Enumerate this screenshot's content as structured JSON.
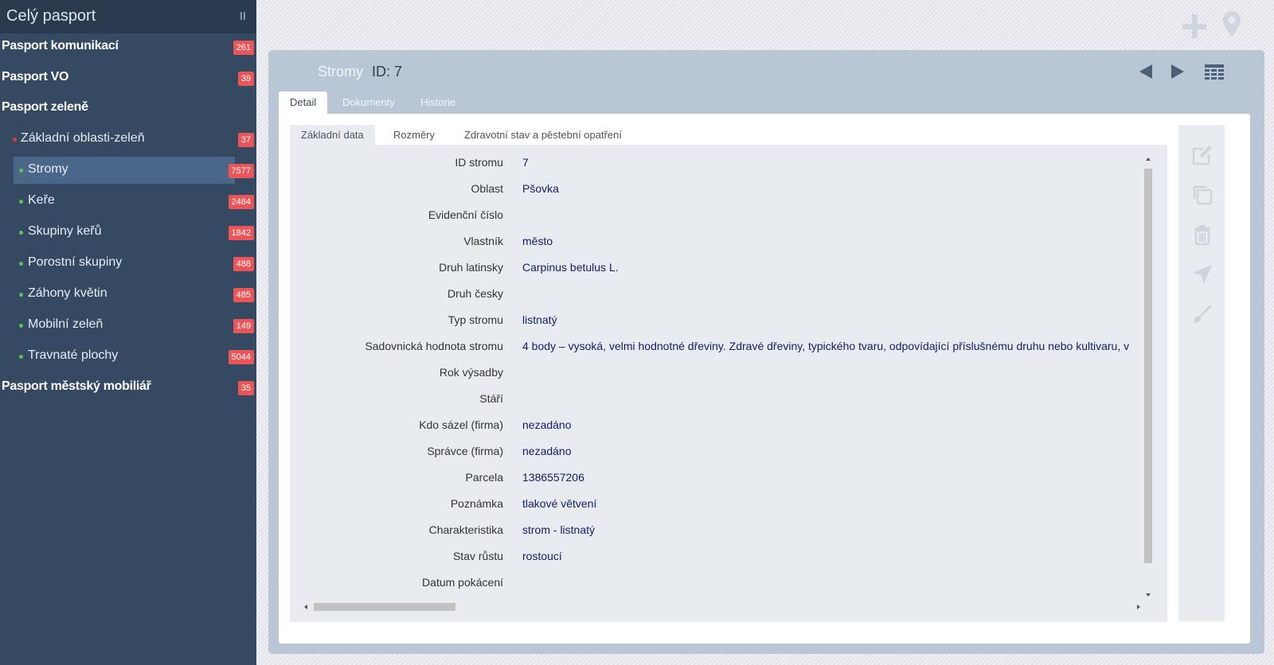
{
  "sidebar": {
    "title": "Celý pasport",
    "items": [
      {
        "label": "Pasport komunikací",
        "count": "261"
      },
      {
        "label": "Pasport VO",
        "count": "39"
      },
      {
        "label": "Pasport zeleně",
        "count": ""
      },
      {
        "label": "Základní oblasti-zeleň",
        "count": "37"
      },
      {
        "label": "Stromy",
        "count": "7577"
      },
      {
        "label": "Keře",
        "count": "2484"
      },
      {
        "label": "Skupiny keřů",
        "count": "1842"
      },
      {
        "label": "Porostní skupiny",
        "count": "488"
      },
      {
        "label": "Záhony květin",
        "count": "485"
      },
      {
        "label": "Mobilní zeleň",
        "count": "149"
      },
      {
        "label": "Travnaté plochy",
        "count": "5044"
      },
      {
        "label": "Pasport městský mobiliář",
        "count": "35"
      }
    ]
  },
  "header": {
    "entity": "Stromy",
    "id_label": "ID: 7"
  },
  "tabs_outer": [
    "Detail",
    "Dokumenty",
    "Historie"
  ],
  "tabs_inner": [
    "Základní data",
    "Rozměry",
    "Zdravotní stav a pěstební opatření"
  ],
  "fields": [
    {
      "label": "ID stromu",
      "value": "7"
    },
    {
      "label": "Oblast",
      "value": "Pšovka"
    },
    {
      "label": "Evidenční číslo",
      "value": ""
    },
    {
      "label": "Vlastník",
      "value": "město"
    },
    {
      "label": "Druh latinsky",
      "value": "Carpinus betulus L."
    },
    {
      "label": "Druh česky",
      "value": ""
    },
    {
      "label": "Typ stromu",
      "value": "listnatý"
    },
    {
      "label": "Sadovnická hodnota stromu",
      "value": "4 body – vysoká, velmi hodnotné dřeviny. Zdravé dřeviny, typického tvaru, odpovídající příslušnému druhu nebo kultivaru, v"
    },
    {
      "label": "Rok výsadby",
      "value": ""
    },
    {
      "label": "Stáří",
      "value": ""
    },
    {
      "label": "Kdo sázel (firma)",
      "value": "nezadáno"
    },
    {
      "label": "Správce (firma)",
      "value": "nezadáno"
    },
    {
      "label": "Parcela",
      "value": "1386557206"
    },
    {
      "label": "Poznámka",
      "value": "tlakové větvení"
    },
    {
      "label": "Charakteristika",
      "value": "strom - listnatý"
    },
    {
      "label": "Stav růstu",
      "value": "rostoucí"
    },
    {
      "label": "Datum pokácení",
      "value": ""
    }
  ],
  "colors": {
    "sidebar_bg": "#354a62",
    "badge": "#ec5557",
    "active_item": "#4a6689",
    "panel": "#b8c6d6",
    "value_text": "#13216a"
  }
}
